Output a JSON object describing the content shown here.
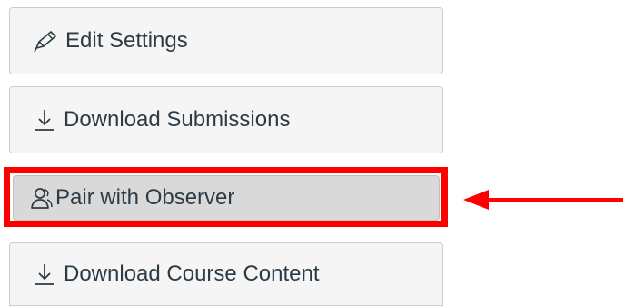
{
  "course_menu": {
    "edit_settings": {
      "label": "Edit Settings",
      "icon": "pencil-icon"
    },
    "download_submissions": {
      "label": "Download Submissions",
      "icon": "download-icon"
    },
    "pair_with_observer": {
      "label": "Pair with Observer",
      "icon": "users-icon"
    },
    "download_course_content": {
      "label": "Download Course Content",
      "icon": "download-icon"
    }
  },
  "annotation": {
    "highlight_color": "#ff0000",
    "target": "pair_with_observer"
  },
  "colors": {
    "button_bg": "#f5f5f5",
    "button_border": "#c7cdd1",
    "selected_bg": "#d9d9d9",
    "text": "#2d3b45"
  }
}
